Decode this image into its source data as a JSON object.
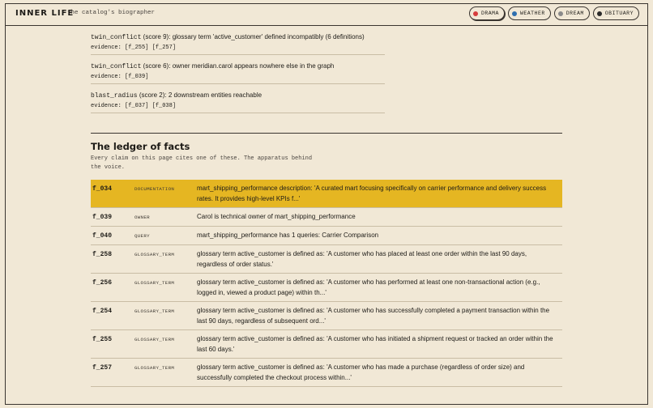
{
  "header": {
    "brand": "INNER LIFE",
    "tagline": "the catalog's biographer",
    "modes": [
      {
        "label": "DRAMA",
        "color": "#d63c3c",
        "active": true
      },
      {
        "label": "WEATHER",
        "color": "#2f6fae",
        "active": false
      },
      {
        "label": "DREAM",
        "color": "#8a8a8a",
        "active": false
      },
      {
        "label": "OBITUARY",
        "color": "#2b2b2b",
        "active": false
      }
    ]
  },
  "findings": [
    {
      "code": "twin_conflict",
      "score": "(score 9):",
      "text": "glossary term 'active_customer' defined incompatibly (6 definitions)",
      "evidence": "evidence: [f_255] [f_257]"
    },
    {
      "code": "twin_conflict",
      "score": "(score 6):",
      "text": "owner meridian.carol appears nowhere else in the graph",
      "evidence": "evidence: [f_039]"
    },
    {
      "code": "blast_radius",
      "score": "(score 2):",
      "text": "2 downstream entities reachable",
      "evidence": "evidence: [f_037] [f_038]"
    }
  ],
  "ledger": {
    "title": "The ledger of facts",
    "subtitle": "Every claim on this page cites one of these. The apparatus behind the voice.",
    "rows": [
      {
        "id": "f_034",
        "kind": "DOCUMENTATION",
        "text": "mart_shipping_performance description: 'A curated mart focusing specifically on carrier performance and delivery success rates. It provides high-level KPIs f...'"
      },
      {
        "id": "f_039",
        "kind": "OWNER",
        "text": "Carol is technical owner of mart_shipping_performance"
      },
      {
        "id": "f_040",
        "kind": "QUERY",
        "text": "mart_shipping_performance has 1 queries: Carrier Comparison"
      },
      {
        "id": "f_258",
        "kind": "GLOSSARY_TERM",
        "text": "glossary term active_customer is defined as: 'A customer who has placed at least one order within the last 90 days, regardless of order status.'"
      },
      {
        "id": "f_256",
        "kind": "GLOSSARY_TERM",
        "text": "glossary term active_customer is defined as: 'A customer who has performed at least one non-transactional action (e.g., logged in, viewed a product page) within th...'"
      },
      {
        "id": "f_254",
        "kind": "GLOSSARY_TERM",
        "text": "glossary term active_customer is defined as: 'A customer who has successfully completed a payment transaction within the last 90 days, regardless of subsequent ord...'"
      },
      {
        "id": "f_255",
        "kind": "GLOSSARY_TERM",
        "text": "glossary term active_customer is defined as: 'A customer who has initiated a shipment request or tracked an order within the last 60 days.'"
      },
      {
        "id": "f_257",
        "kind": "GLOSSARY_TERM",
        "text": "glossary term active_customer is defined as: 'A customer who has made a purchase (regardless of order size) and successfully completed the checkout process within...'"
      }
    ]
  }
}
